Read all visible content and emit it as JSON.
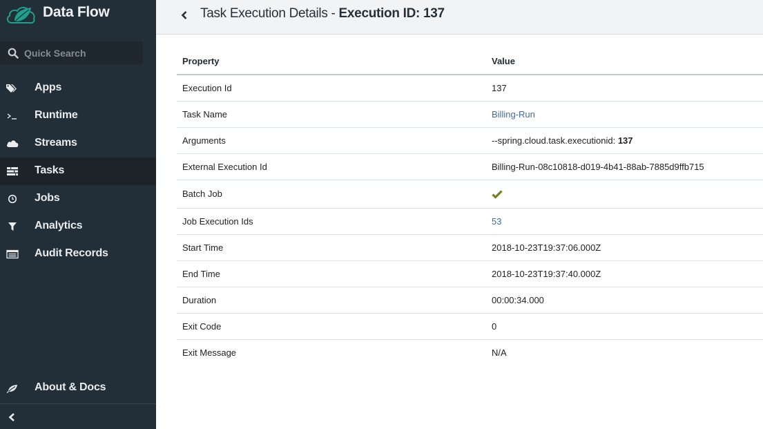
{
  "app": {
    "title": "Data Flow",
    "accent_color": "#1fa08e"
  },
  "search": {
    "placeholder": "Quick Search",
    "value": ""
  },
  "sidebar": {
    "items": [
      {
        "label": "Apps",
        "icon": "tags-icon",
        "active": false
      },
      {
        "label": "Runtime",
        "icon": "terminal-icon",
        "active": false
      },
      {
        "label": "Streams",
        "icon": "cloud-icon",
        "active": false
      },
      {
        "label": "Tasks",
        "icon": "tasks-icon",
        "active": true
      },
      {
        "label": "Jobs",
        "icon": "clock-icon",
        "active": false
      },
      {
        "label": "Analytics",
        "icon": "filter-icon",
        "active": false
      },
      {
        "label": "Audit Records",
        "icon": "list-icon",
        "active": false
      }
    ],
    "about_label": "About & Docs",
    "about_icon": "leaf-icon",
    "collapse_icon": "chevron-left-icon"
  },
  "header": {
    "title_prefix": "Task Execution Details - ",
    "title_bold": "Execution ID: 137",
    "back_icon": "chevron-left-icon"
  },
  "table": {
    "columns": [
      "Property",
      "Value"
    ],
    "rows": [
      {
        "property": "Execution Id",
        "value": "137"
      },
      {
        "property": "Task Name",
        "value": "Billing-Run",
        "link": true
      },
      {
        "property": "Arguments",
        "value_prefix": "--spring.cloud.task.executionid: ",
        "value_bold": "137"
      },
      {
        "property": "External Execution Id",
        "value": "Billing-Run-08c10818-d019-4b41-88ab-7885d9ffb715"
      },
      {
        "property": "Batch Job",
        "value": "true",
        "icon": "check-icon",
        "icon_color": "#7b7a2e"
      },
      {
        "property": "Job Execution Ids",
        "value": "53",
        "link": true
      },
      {
        "property": "Start Time",
        "value": "2018-10-23T19:37:06.000Z"
      },
      {
        "property": "End Time",
        "value": "2018-10-23T19:37:40.000Z"
      },
      {
        "property": "Duration",
        "value": "00:00:34.000"
      },
      {
        "property": "Exit Code",
        "value": "0"
      },
      {
        "property": "Exit Message",
        "value": "N/A"
      }
    ]
  }
}
